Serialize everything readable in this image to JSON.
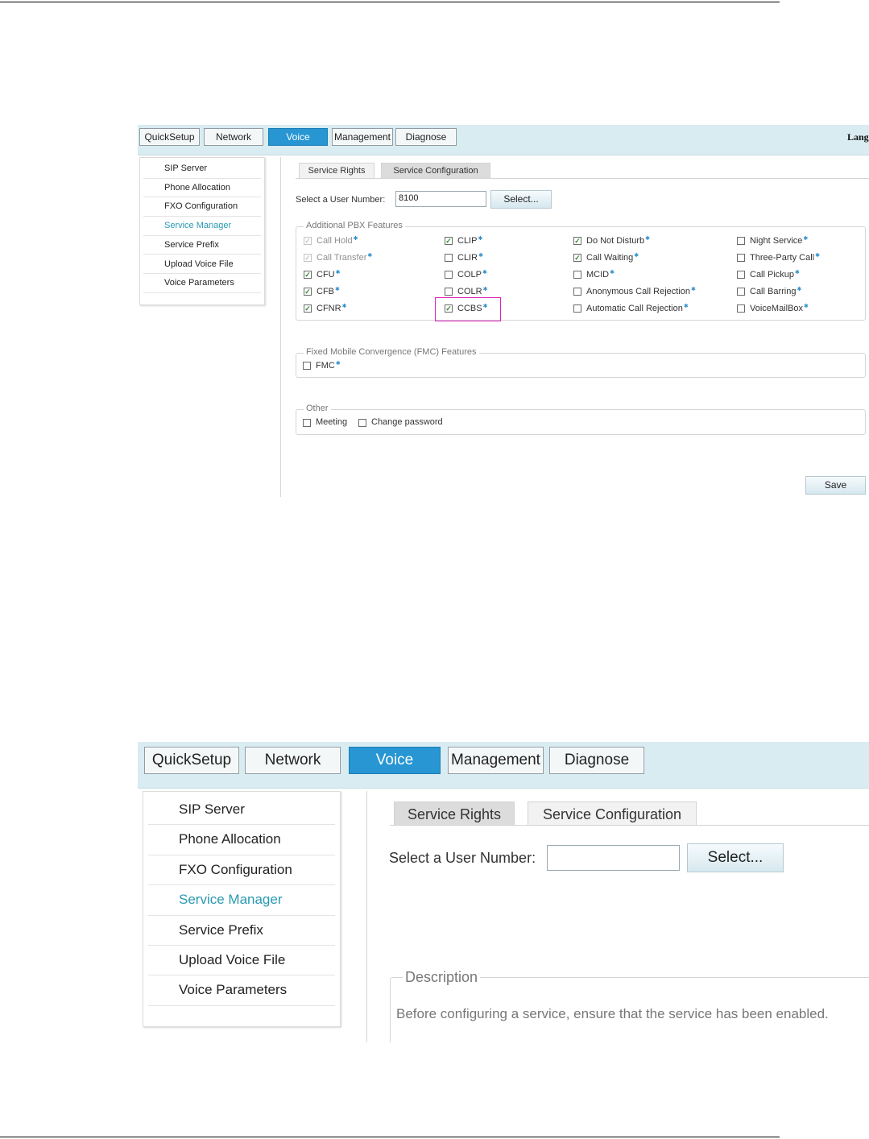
{
  "screen1": {
    "nav": [
      "QuickSetup",
      "Network",
      "Voice",
      "Management",
      "Diagnose"
    ],
    "active_nav": "Voice",
    "lang_label": "Lang",
    "sidebar": [
      "SIP Server",
      "Phone Allocation",
      "FXO Configuration",
      "Service Manager",
      "Service Prefix",
      "Upload Voice File",
      "Voice Parameters"
    ],
    "selected_sidebar": "Service Manager",
    "tabs": [
      "Service Rights",
      "Service Configuration"
    ],
    "user_number_label": "Select a User Number:",
    "user_number_value": "8100",
    "select_button": "Select...",
    "pbx": {
      "title": "Additional PBX Features",
      "items": [
        {
          "label": "Call Hold",
          "checked": true,
          "disabled": true
        },
        {
          "label": "Call Transfer",
          "checked": true,
          "disabled": true
        },
        {
          "label": "CFU",
          "checked": true,
          "disabled": false
        },
        {
          "label": "CFB",
          "checked": true,
          "disabled": false
        },
        {
          "label": "CFNR",
          "checked": true,
          "disabled": false
        },
        {
          "label": "CLIP",
          "checked": true,
          "disabled": false
        },
        {
          "label": "CLIR",
          "checked": false,
          "disabled": false
        },
        {
          "label": "COLP",
          "checked": false,
          "disabled": false
        },
        {
          "label": "COLR",
          "checked": false,
          "disabled": false
        },
        {
          "label": "CCBS",
          "checked": true,
          "disabled": false,
          "highlighted": true
        },
        {
          "label": "Do Not Disturb",
          "checked": true,
          "disabled": false
        },
        {
          "label": "Call Waiting",
          "checked": true,
          "disabled": false
        },
        {
          "label": "MCID",
          "checked": false,
          "disabled": false
        },
        {
          "label": "Anonymous Call Rejection",
          "checked": false,
          "disabled": false
        },
        {
          "label": "Automatic Call Rejection",
          "checked": false,
          "disabled": false
        },
        {
          "label": "Night Service",
          "checked": false,
          "disabled": false
        },
        {
          "label": "Three-Party Call",
          "checked": false,
          "disabled": false
        },
        {
          "label": "Call Pickup",
          "checked": false,
          "disabled": false
        },
        {
          "label": "Call Barring",
          "checked": false,
          "disabled": false
        },
        {
          "label": "VoiceMailBox",
          "checked": false,
          "disabled": false
        }
      ]
    },
    "fmc": {
      "title": "Fixed Mobile Convergence (FMC) Features",
      "items": [
        {
          "label": "FMC",
          "checked": false
        }
      ]
    },
    "other": {
      "title": "Other",
      "items": [
        {
          "label": "Meeting",
          "checked": false
        },
        {
          "label": "Change password",
          "checked": false
        }
      ]
    },
    "save_button": "Save"
  },
  "screen2": {
    "nav": [
      "QuickSetup",
      "Network",
      "Voice",
      "Management",
      "Diagnose"
    ],
    "active_nav": "Voice",
    "sidebar": [
      "SIP Server",
      "Phone Allocation",
      "FXO Configuration",
      "Service Manager",
      "Service Prefix",
      "Upload Voice File",
      "Voice Parameters"
    ],
    "selected_sidebar": "Service Manager",
    "tabs": [
      "Service Rights",
      "Service Configuration"
    ],
    "user_number_label": "Select a User Number:",
    "user_number_value": "",
    "select_button": "Select...",
    "description_title": "Description",
    "description_text": "Before configuring a service, ensure that the service has been enabled."
  },
  "colors": {
    "topbar": "#d9ecf2",
    "active_nav": "#2796d3",
    "selected_sidebar_text": "#2a9ab1",
    "checkmark": "#2f8a2f",
    "highlight_box": "#e020c0"
  },
  "icons": {
    "checkbox_checked": "check-mark",
    "feature_marker": "superscript-star"
  }
}
